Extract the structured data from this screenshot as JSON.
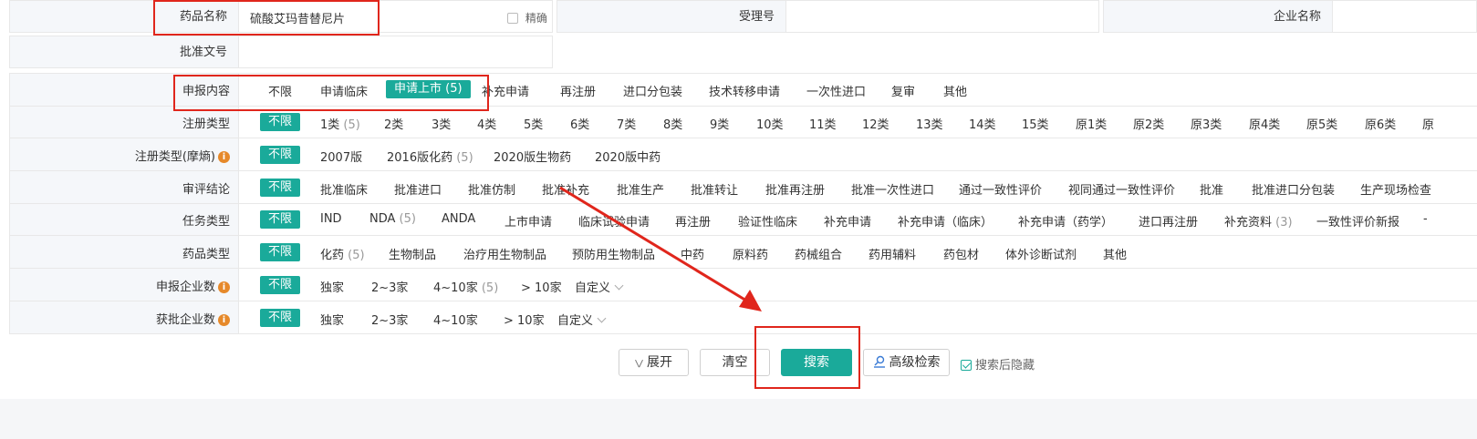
{
  "top": {
    "drug_name_label": "药品名称",
    "drug_name_value": "硫酸艾玛昔替尼片",
    "exact_label": "精确",
    "acceptance_label": "受理号",
    "company_label": "企业名称",
    "approval_label": "批准文号"
  },
  "filters": {
    "declaration": {
      "label": "申报内容",
      "options": [
        {
          "label": "不限"
        },
        {
          "label": "申请临床"
        },
        {
          "label": "申请上市 (5)",
          "selected": true
        },
        {
          "label": "补充申请"
        },
        {
          "label": "再注册"
        },
        {
          "label": "进口分包装"
        },
        {
          "label": "技术转移申请"
        },
        {
          "label": "一次性进口"
        },
        {
          "label": "复审"
        },
        {
          "label": "其他"
        }
      ]
    },
    "reg_type": {
      "label": "注册类型",
      "all": "不限",
      "options": [
        {
          "label": "1类",
          "count": "(5)"
        },
        {
          "label": "2类"
        },
        {
          "label": "3类"
        },
        {
          "label": "4类"
        },
        {
          "label": "5类"
        },
        {
          "label": "6类"
        },
        {
          "label": "7类"
        },
        {
          "label": "8类"
        },
        {
          "label": "9类"
        },
        {
          "label": "10类"
        },
        {
          "label": "11类"
        },
        {
          "label": "12类"
        },
        {
          "label": "13类"
        },
        {
          "label": "14类"
        },
        {
          "label": "15类"
        },
        {
          "label": "原1类"
        },
        {
          "label": "原2类"
        },
        {
          "label": "原3类"
        },
        {
          "label": "原4类"
        },
        {
          "label": "原5类"
        },
        {
          "label": "原6类"
        },
        {
          "label": "原"
        }
      ]
    },
    "reg_type_moxi": {
      "label": "注册类型(摩熵)",
      "all": "不限",
      "options": [
        {
          "label": "2007版"
        },
        {
          "label": "2016版化药",
          "count": "(5)"
        },
        {
          "label": "2020版生物药"
        },
        {
          "label": "2020版中药"
        }
      ]
    },
    "review": {
      "label": "审评结论",
      "all": "不限",
      "options": [
        {
          "label": "批准临床"
        },
        {
          "label": "批准进口"
        },
        {
          "label": "批准仿制"
        },
        {
          "label": "批准补充"
        },
        {
          "label": "批准生产"
        },
        {
          "label": "批准转让"
        },
        {
          "label": "批准再注册"
        },
        {
          "label": "批准一次性进口"
        },
        {
          "label": "通过一致性评价"
        },
        {
          "label": "视同通过一致性评价"
        },
        {
          "label": "批准"
        },
        {
          "label": "批准进口分包装"
        },
        {
          "label": "生产现场检查"
        }
      ]
    },
    "task": {
      "label": "任务类型",
      "all": "不限",
      "options": [
        {
          "label": "IND"
        },
        {
          "label": "NDA",
          "count": "(5)"
        },
        {
          "label": "ANDA"
        },
        {
          "label": "上市申请"
        },
        {
          "label": "临床试验申请"
        },
        {
          "label": "再注册"
        },
        {
          "label": "验证性临床"
        },
        {
          "label": "补充申请"
        },
        {
          "label": "补充申请（临床）"
        },
        {
          "label": "补充申请（药学）"
        },
        {
          "label": "进口再注册"
        },
        {
          "label": "补充资料",
          "count": "(3)"
        },
        {
          "label": "一致性评价新报"
        },
        {
          "label": "-"
        }
      ]
    },
    "drug_type": {
      "label": "药品类型",
      "all": "不限",
      "options": [
        {
          "label": "化药",
          "count": "(5)"
        },
        {
          "label": "生物制品"
        },
        {
          "label": "治疗用生物制品"
        },
        {
          "label": "预防用生物制品"
        },
        {
          "label": "中药"
        },
        {
          "label": "原料药"
        },
        {
          "label": "药械组合"
        },
        {
          "label": "药用辅料"
        },
        {
          "label": "药包材"
        },
        {
          "label": "体外诊断试剂"
        },
        {
          "label": "其他"
        }
      ]
    },
    "declare_companies": {
      "label": "申报企业数",
      "all": "不限",
      "options": [
        {
          "label": "独家"
        },
        {
          "label": "2~3家"
        },
        {
          "label": "4~10家",
          "count": "(5)"
        },
        {
          "label": "> 10家"
        }
      ],
      "custom": "自定义"
    },
    "approved_companies": {
      "label": "获批企业数",
      "all": "不限",
      "options": [
        {
          "label": "独家"
        },
        {
          "label": "2~3家"
        },
        {
          "label": "4~10家"
        },
        {
          "label": "> 10家"
        }
      ],
      "custom": "自定义"
    }
  },
  "buttons": {
    "expand": "展开",
    "clear": "清空",
    "search": "搜索",
    "advanced": "高级检索",
    "hide_after_search": "搜索后隐藏"
  },
  "colors": {
    "accent": "#1aaa9a",
    "highlight_red": "#e0261c",
    "label_bg": "#f5f7fa",
    "info_orange": "#e6892a"
  }
}
